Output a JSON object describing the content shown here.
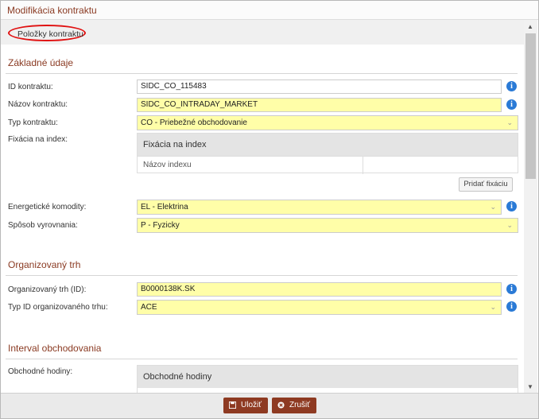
{
  "window": {
    "title": "Modifikácia kontraktu"
  },
  "tabs": [
    {
      "label": "Položky kontraktu"
    }
  ],
  "sections": {
    "basic": {
      "title": "Základné údaje",
      "contract_id": {
        "label": "ID kontraktu:",
        "value": "SIDC_CO_115483"
      },
      "contract_name": {
        "label": "Názov kontraktu:",
        "value": "SIDC_CO_INTRADAY_MARKET"
      },
      "contract_type": {
        "label": "Typ kontraktu:",
        "value": "CO - Priebežné obchodovanie"
      },
      "index_fixing": {
        "label": "Fixácia na index:",
        "table_title": "Fixácia na index",
        "column_header": "Názov indexu",
        "add_button": "Pridať fixáciu"
      },
      "commodities": {
        "label": "Energetické komodity:",
        "value": "EL - Elektrina"
      },
      "settlement": {
        "label": "Spôsob vyrovnania:",
        "value": "P - Fyzicky"
      }
    },
    "organized_market": {
      "title": "Organizovaný trh",
      "market_id": {
        "label": "Organizovaný trh (ID):",
        "value": "B0000138K.SK"
      },
      "market_id_type": {
        "label": "Typ ID organizovaného trhu:",
        "value": "ACE"
      }
    },
    "trading_interval": {
      "title": "Interval obchodovania",
      "hours": {
        "label": "Obchodné hodiny:",
        "table_title": "Obchodné hodiny"
      }
    }
  },
  "footer": {
    "save_label": "Uložiť",
    "cancel_label": "Zrušiť"
  },
  "colors": {
    "accent": "#8e3a22",
    "required_field": "#fffea8",
    "info_icon": "#2a7ad6",
    "tab_highlight": "#e01010"
  }
}
